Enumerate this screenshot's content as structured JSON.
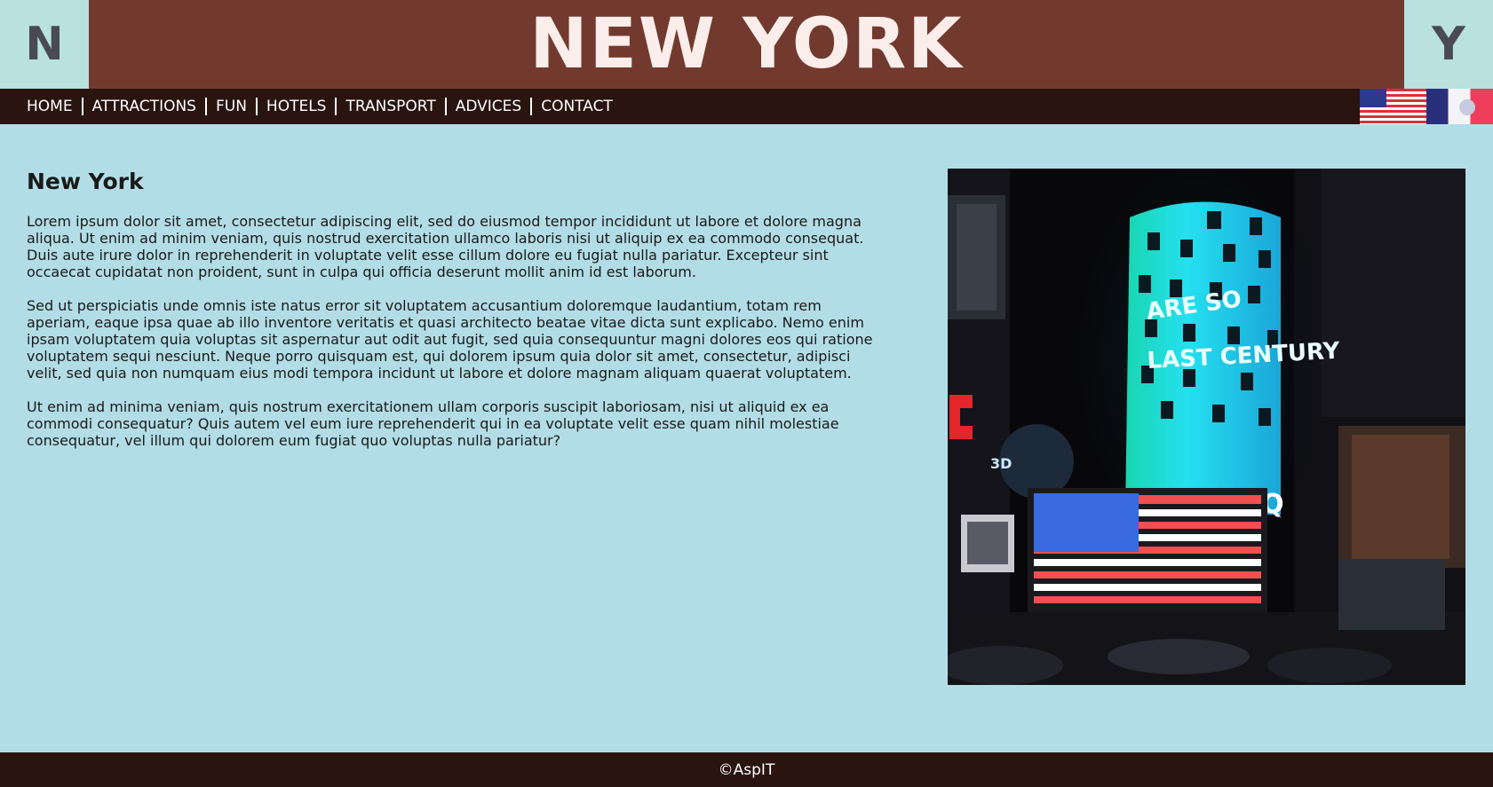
{
  "header": {
    "left_letter": "N",
    "title": "NEW YORK",
    "right_letter": "Y"
  },
  "nav": {
    "items": [
      "HOME",
      "ATTRACTIONS",
      "FUN",
      "HOTELS",
      "TRANSPORT",
      "ADVICES",
      "CONTACT"
    ]
  },
  "flags": [
    "us-flag-icon",
    "france-flag-icon"
  ],
  "main": {
    "heading": "New York",
    "paragraphs": [
      "Lorem ipsum dolor sit amet, consectetur adipiscing elit, sed do eiusmod tempor incididunt ut labore et dolore magna aliqua. Ut enim ad minim veniam, quis nostrud exercitation ullamco laboris nisi ut aliquip ex ea commodo consequat. Duis aute irure dolor in reprehenderit in voluptate velit esse cillum dolore eu fugiat nulla pariatur. Excepteur sint occaecat cupidatat non proident, sunt in culpa qui officia deserunt mollit anim id est laborum.",
      "Sed ut perspiciatis unde omnis iste natus error sit voluptatem accusantium doloremque laudantium, totam rem aperiam, eaque ipsa quae ab illo inventore veritatis et quasi architecto beatae vitae dicta sunt explicabo. Nemo enim ipsam voluptatem quia voluptas sit aspernatur aut odit aut fugit, sed quia consequuntur magni dolores eos qui ratione voluptatem sequi nesciunt. Neque porro quisquam est, qui dolorem ipsum quia dolor sit amet, consectetur, adipisci velit, sed quia non numquam eius modi tempora incidunt ut labore et dolore magnam aliquam quaerat voluptatem.",
      "Ut enim ad minima veniam, quis nostrum exercitationem ullam corporis suscipit laboriosam, nisi ut aliquid ex ea commodi consequatur? Quis autem vel eum iure reprehenderit qui in ea voluptate velit esse quam nihil molestiae consequatur, vel illum qui dolorem eum fugiat quo voluptas nulla pariatur?"
    ],
    "photo": {
      "sign_line1": "ARE SO",
      "sign_line2": "LAST CENTURY",
      "sign_3d": "3D",
      "sign_nasdaq": "DAQ"
    }
  },
  "footer": {
    "text": "©AspIT"
  },
  "colors": {
    "header_bg": "#723a2e",
    "corner_bg": "#b8e1e0",
    "nav_bg": "#2a1410",
    "page_bg": "#b2dde6"
  }
}
